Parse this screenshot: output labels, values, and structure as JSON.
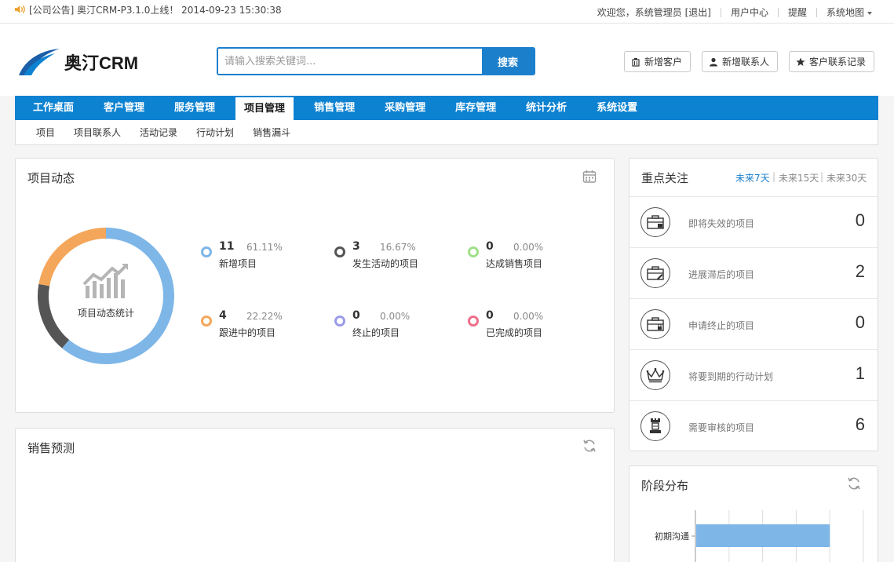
{
  "topbar": {
    "notice": "[公司公告] 奥汀CRM-P3.1.0上线！ 2014-09-23 15:30:38",
    "welcome": "欢迎您，系统管理员 [退出]",
    "user_center": "用户中心",
    "reminder": "提醒",
    "sitemap": "系统地图"
  },
  "brand": {
    "logo_text": "奥汀CRM",
    "accent": "#0d82d1"
  },
  "search": {
    "placeholder": "请输入搜索关键词...",
    "button": "搜索"
  },
  "quick_actions": [
    {
      "label": "新增客户",
      "icon": "building-icon"
    },
    {
      "label": "新增联系人",
      "icon": "user-icon"
    },
    {
      "label": "客户联系记录",
      "icon": "star-icon"
    }
  ],
  "nav": {
    "items": [
      "工作桌面",
      "客户管理",
      "服务管理",
      "项目管理",
      "销售管理",
      "采购管理",
      "库存管理",
      "统计分析",
      "系统设置"
    ],
    "active": "项目管理"
  },
  "subnav": [
    "项目",
    "项目联系人",
    "活动记录",
    "行动计划",
    "销售漏斗"
  ],
  "project_dynamics": {
    "title": "项目动态",
    "center_label": "项目动态统计",
    "stats": [
      {
        "num": "11",
        "pct": "61.11%",
        "label": "新增项目",
        "color": "#7eb6e8"
      },
      {
        "num": "3",
        "pct": "16.67%",
        "label": "发生活动的项目",
        "color": "#555555"
      },
      {
        "num": "0",
        "pct": "0.00%",
        "label": "达成销售项目",
        "color": "#9ee08a"
      },
      {
        "num": "4",
        "pct": "22.22%",
        "label": "跟进中的项目",
        "color": "#f4a65a"
      },
      {
        "num": "0",
        "pct": "0.00%",
        "label": "终止的项目",
        "color": "#9b9be8"
      },
      {
        "num": "0",
        "pct": "0.00%",
        "label": "已完成的项目",
        "color": "#ee6f8a"
      }
    ]
  },
  "sales_forecast": {
    "title": "销售预测"
  },
  "focus": {
    "title": "重点关注",
    "tabs": [
      "未来7天",
      "未来15天",
      "未来30天"
    ],
    "active_tab": "未来7天",
    "rows": [
      {
        "label": "即将失效的项目",
        "value": "0",
        "icon": "briefcase-clock-icon"
      },
      {
        "label": "进展滞后的项目",
        "value": "2",
        "icon": "briefcase-edit-icon"
      },
      {
        "label": "申请终止的项目",
        "value": "0",
        "icon": "briefcase-lock-icon"
      },
      {
        "label": "将要到期的行动计划",
        "value": "1",
        "icon": "crown-icon"
      },
      {
        "label": "需要审核的项目",
        "value": "6",
        "icon": "chess-rook-icon"
      }
    ]
  },
  "stage_distribution": {
    "title": "阶段分布",
    "chart_data": {
      "type": "bar",
      "orientation": "horizontal",
      "categories": [
        "初期沟通"
      ],
      "values": [
        4
      ],
      "xlim": [
        0,
        5
      ],
      "grid": true,
      "bar_color": "#7eb6e8"
    }
  }
}
